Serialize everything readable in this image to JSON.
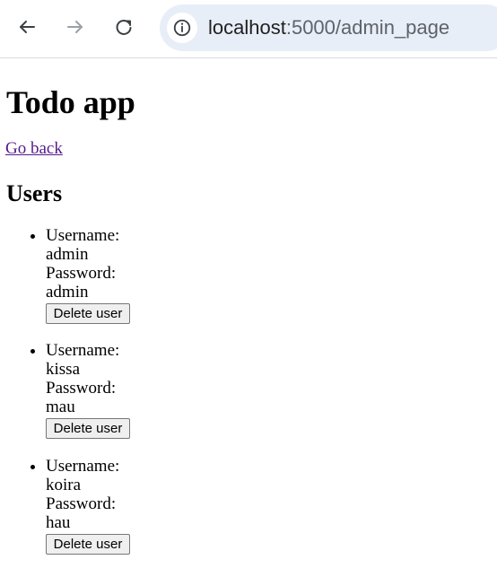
{
  "browser": {
    "icons": {
      "back": "arrow-left-icon",
      "forward": "arrow-right-icon",
      "reload": "reload-icon",
      "site_info": "info-icon"
    },
    "address_bar": {
      "host": "localhost",
      "path": ":5000/admin_page"
    }
  },
  "page": {
    "title": "Todo app",
    "go_back_link": "Go back",
    "users_heading": "Users",
    "users": [
      {
        "username_label": "Username:",
        "username": "admin",
        "password_label": "Password:",
        "password": "admin",
        "delete_label": "Delete user"
      },
      {
        "username_label": "Username:",
        "username": "kissa",
        "password_label": "Password:",
        "password": "mau",
        "delete_label": "Delete user"
      },
      {
        "username_label": "Username:",
        "username": "koira",
        "password_label": "Password:",
        "password": "hau",
        "delete_label": "Delete user"
      }
    ]
  },
  "colors": {
    "link_visited": "#551a8b",
    "address_bar_bg": "#e8eef8",
    "disabled_icon": "#9aa0a6",
    "active_icon": "#3c4043"
  }
}
